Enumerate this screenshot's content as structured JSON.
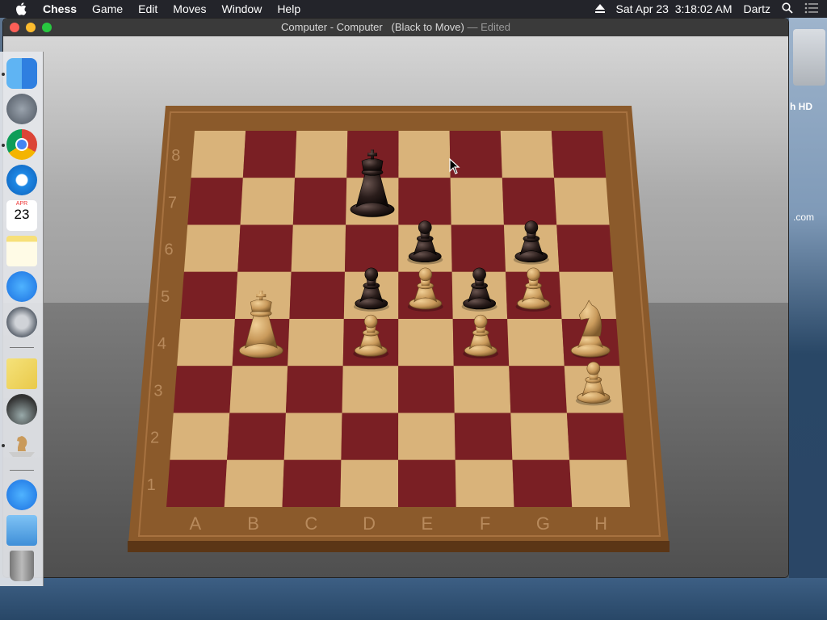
{
  "menubar": {
    "app_name": "Chess",
    "menus": [
      "Game",
      "Edit",
      "Moves",
      "Window",
      "Help"
    ],
    "clock": "Sat Apr 23  3:18:02 AM",
    "user": "Dartz"
  },
  "window": {
    "title": "Computer - Computer   (Black to Move)",
    "edited": "— Edited"
  },
  "desktop": {
    "hd_label": "h HD",
    "com_label": ".com"
  },
  "dock": {
    "items": [
      "finder-icon",
      "launchpad-icon",
      "chrome-icon",
      "safari-icon",
      "calendar-icon",
      "notes-icon",
      "app-store-icon",
      "system-preferences-icon",
      "stickies-icon",
      "grapher-icon",
      "chess-icon",
      "app-store-icon",
      "downloads-folder-icon",
      "trash-icon"
    ],
    "calendar": {
      "month": "APR",
      "day": "23"
    }
  },
  "board": {
    "files": [
      "A",
      "B",
      "C",
      "D",
      "E",
      "F",
      "G",
      "H"
    ],
    "ranks": [
      "8",
      "7",
      "6",
      "5",
      "4",
      "3",
      "2",
      "1"
    ],
    "pieces": [
      {
        "color": "black",
        "type": "king",
        "square": "d7"
      },
      {
        "color": "black",
        "type": "pawn",
        "square": "e6"
      },
      {
        "color": "black",
        "type": "pawn",
        "square": "g6"
      },
      {
        "color": "black",
        "type": "pawn",
        "square": "d5"
      },
      {
        "color": "black",
        "type": "pawn",
        "square": "f5"
      },
      {
        "color": "white",
        "type": "pawn",
        "square": "e5"
      },
      {
        "color": "white",
        "type": "pawn",
        "square": "g5"
      },
      {
        "color": "white",
        "type": "king",
        "square": "b4"
      },
      {
        "color": "white",
        "type": "pawn",
        "square": "d4"
      },
      {
        "color": "white",
        "type": "pawn",
        "square": "f4"
      },
      {
        "color": "white",
        "type": "knight",
        "square": "h4"
      },
      {
        "color": "white",
        "type": "pawn",
        "square": "h3"
      }
    ]
  },
  "colors": {
    "light_square": "#d9b37a",
    "dark_square": "#7a1f24",
    "frame": "#8b5a2b",
    "white_piece": "#c99a5b",
    "black_piece": "#2a1d1b"
  }
}
